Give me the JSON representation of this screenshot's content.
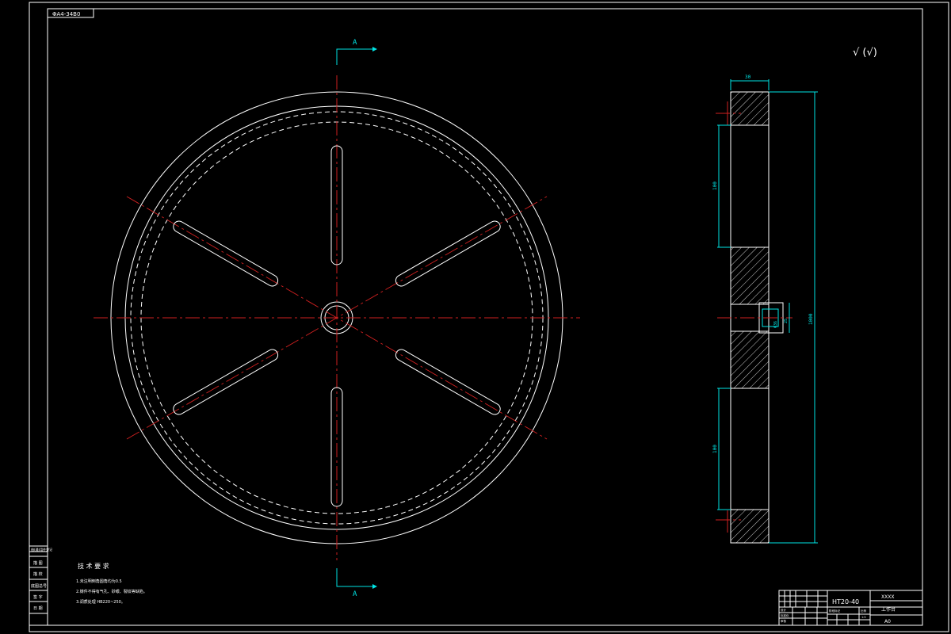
{
  "drawing_id_label": "ΦA4-34B0",
  "section_label_top": "A",
  "section_label_bottom": "A",
  "roughness_symbol": "√ (√)",
  "tech_requirements": {
    "title": "技 术 要 求",
    "lines": [
      "1.未注明倒角圆角均为0.5",
      "2.铸件不得有气孔、砂眼、裂纹等缺陷。",
      "3.调质处理 HB220~250。"
    ]
  },
  "left_stamp_cells": [
    "借(通)用件登记",
    "描 图",
    "描 校",
    "底图总号",
    "签 字",
    "日 期"
  ],
  "title_block": {
    "material": "HT20-40",
    "company": "XXXX",
    "part_name": "工作台",
    "drawing_no": "A0",
    "labels": [
      "标记",
      "处数",
      "分区",
      "更改文件号",
      "签名",
      "年月日",
      "设计",
      "标准化",
      "审核",
      "工艺",
      "批准",
      "阶段标记",
      "重量",
      "比例",
      "共",
      "张",
      "第",
      "张",
      "1:5"
    ]
  },
  "dimensions": {
    "width_top": "30",
    "upper_gap": "100",
    "lower_gap": "100",
    "overall_height": "1000",
    "bore_diameter": "Φ36",
    "bore_depth": "25"
  },
  "colors": {
    "background": "#000000",
    "outline": "#ffffff",
    "centerline": "#d02020",
    "dimension": "#00e5e5"
  }
}
